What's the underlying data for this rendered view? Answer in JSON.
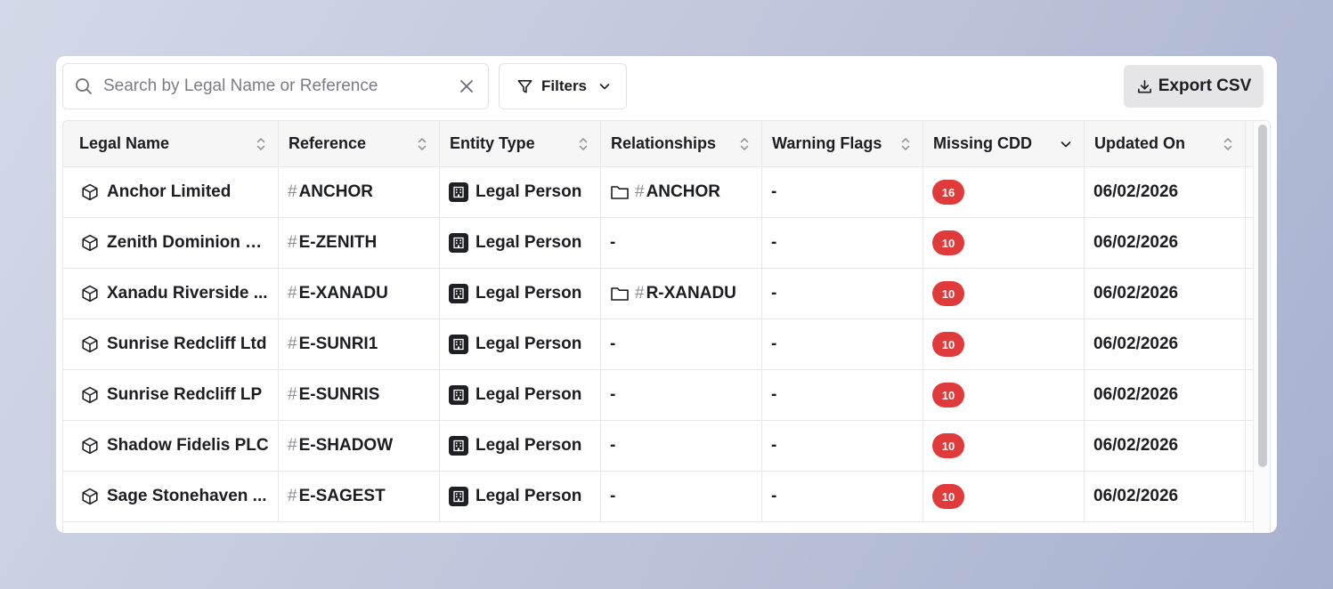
{
  "search": {
    "placeholder": "Search by Legal Name or Reference",
    "value": ""
  },
  "filters": {
    "label": "Filters"
  },
  "export": {
    "label": "Export CSV"
  },
  "columns": [
    "Legal Name",
    "Reference",
    "Entity Type",
    "Relationships",
    "Warning Flags",
    "Missing CDD",
    "Updated On"
  ],
  "rows": [
    {
      "name": "Anchor Limited",
      "ref": "ANCHOR",
      "type": "Legal Person",
      "rel": "ANCHOR",
      "flags": "-",
      "cdd": "16",
      "updated": "06/02/2026"
    },
    {
      "name": "Zenith Dominion L...",
      "ref": "E-ZENITH",
      "type": "Legal Person",
      "rel": "-",
      "flags": "-",
      "cdd": "10",
      "updated": "06/02/2026"
    },
    {
      "name": "Xanadu Riverside ...",
      "ref": "E-XANADU",
      "type": "Legal Person",
      "rel": "R-XANADU",
      "flags": "-",
      "cdd": "10",
      "updated": "06/02/2026"
    },
    {
      "name": "Sunrise Redcliff Ltd",
      "ref": "E-SUNRI1",
      "type": "Legal Person",
      "rel": "-",
      "flags": "-",
      "cdd": "10",
      "updated": "06/02/2026"
    },
    {
      "name": "Sunrise Redcliff LP",
      "ref": "E-SUNRIS",
      "type": "Legal Person",
      "rel": "-",
      "flags": "-",
      "cdd": "10",
      "updated": "06/02/2026"
    },
    {
      "name": "Shadow Fidelis PLC",
      "ref": "E-SHADOW",
      "type": "Legal Person",
      "rel": "-",
      "flags": "-",
      "cdd": "10",
      "updated": "06/02/2026"
    },
    {
      "name": "Sage Stonehaven ...",
      "ref": "E-SAGEST",
      "type": "Legal Person",
      "rel": "-",
      "flags": "-",
      "cdd": "10",
      "updated": "06/02/2026"
    }
  ],
  "ui": {
    "hash": "#"
  },
  "colors": {
    "badge": "#e03a3a",
    "background": "#bcc4da"
  },
  "icons": {
    "search": "search-icon",
    "clear": "close-icon",
    "filter": "filter-icon",
    "export": "download-icon",
    "entity": "cube-icon",
    "entity_type": "building-icon",
    "relationship": "folder-icon"
  }
}
